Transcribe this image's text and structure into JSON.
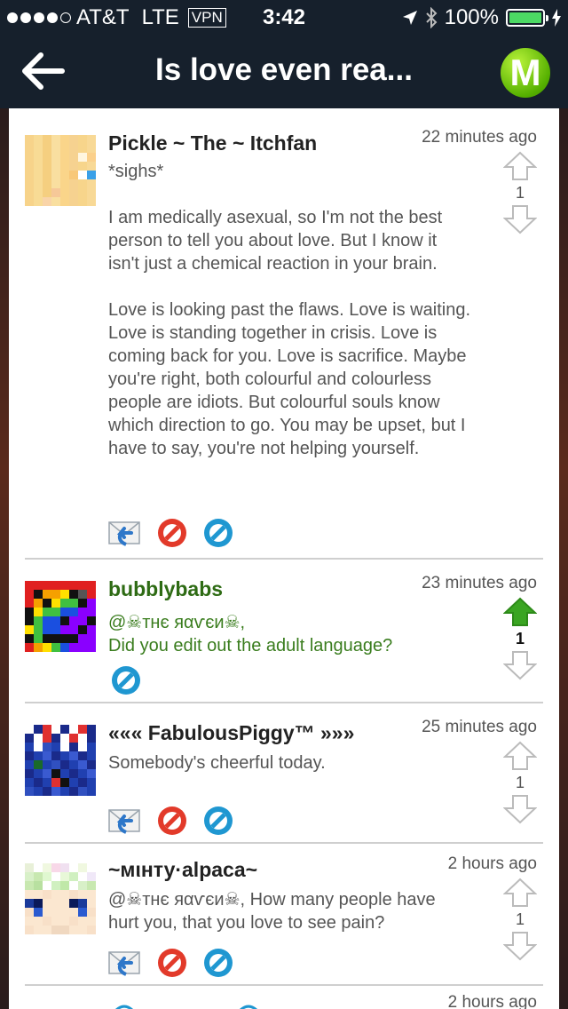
{
  "status": {
    "carrier": "AT&T",
    "network": "LTE",
    "vpn": "VPN",
    "time": "3:42",
    "battery": "100%"
  },
  "nav": {
    "title": "Is love even rea..."
  },
  "posts": [
    {
      "user": "Pickle ~ The ~ Itchfan",
      "time": "22 minutes ago",
      "votes": "1",
      "text": "*sighs*\n\nI am medically asexual, so I'm not the best person to tell you about love. But I know it isn't just a chemical reaction in your brain.\n\nLove is looking past the flaws. Love is waiting. Love is standing together in crisis. Love is coming back for you. Love is sacrifice. Maybe you're right, both colourful and colourless people are idiots. But colourful souls know which direction to go. You may be upset, but I have to say, you're not helping yourself."
    },
    {
      "user": "bubblybabs",
      "time": "23 minutes ago",
      "votes": "1",
      "text": "@☠тнє яαѵєи☠,\nDid you edit out the adult language?"
    },
    {
      "user": "««« FabulousPiggy™ »»»",
      "time": "25 minutes ago",
      "votes": "1",
      "text": "Somebody's cheerful today."
    },
    {
      "user": "~мιнту·alpaca~",
      "time": "2 hours ago",
      "votes": "1",
      "text": "@☠тнє яαѵєи☠, How many people have hurt you, that you love to see pain?"
    },
    {
      "user": "",
      "time": "2 hours ago",
      "votes": "",
      "text": ""
    }
  ],
  "icons": {
    "reply": "reply-mail-icon",
    "flag": "block-icon",
    "hide": "hide-icon",
    "up": "upvote-arrow-icon",
    "down": "downvote-arrow-icon",
    "logo": "m-logo-icon",
    "back": "back-arrow-icon"
  },
  "colors": {
    "bar": "#16202c",
    "accent": "#2e6b14",
    "upActive": "#3aa522"
  }
}
